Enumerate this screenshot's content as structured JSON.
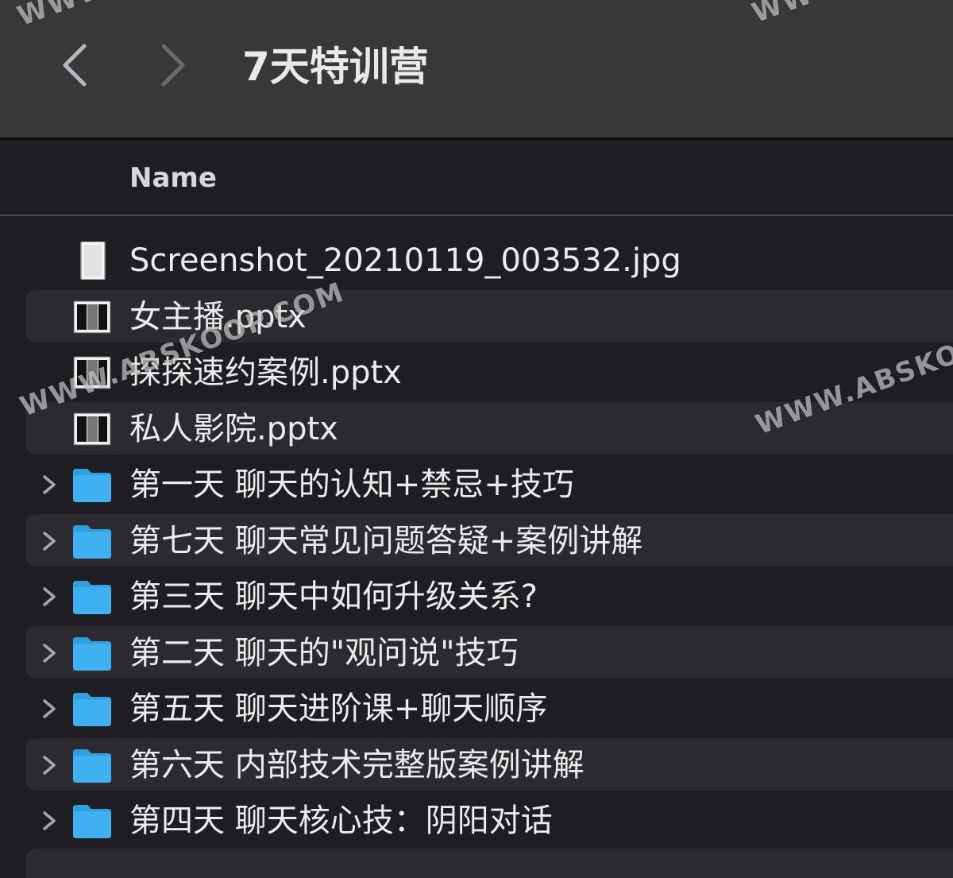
{
  "window": {
    "title": "7天特训营"
  },
  "header": {
    "name_label": "Name"
  },
  "files": [
    {
      "name": "Screenshot_20210119_003532.jpg",
      "kind": "image",
      "icon": "image-file-icon",
      "expandable": false
    },
    {
      "name": "女主播.pptx",
      "kind": "pptx",
      "icon": "pptx-file-icon",
      "expandable": false
    },
    {
      "name": "探探速约案例.pptx",
      "kind": "pptx",
      "icon": "pptx-file-icon",
      "expandable": false
    },
    {
      "name": "私人影院.pptx",
      "kind": "pptx",
      "icon": "pptx-file-icon",
      "expandable": false
    },
    {
      "name": "第一天 聊天的认知+禁忌+技巧",
      "kind": "folder",
      "icon": "folder-icon",
      "expandable": true
    },
    {
      "name": "第七天 聊天常见问题答疑+案例讲解",
      "kind": "folder",
      "icon": "folder-icon",
      "expandable": true
    },
    {
      "name": "第三天 聊天中如何升级关系?",
      "kind": "folder",
      "icon": "folder-icon",
      "expandable": true
    },
    {
      "name": "第二天 聊天的\"观问说\"技巧",
      "kind": "folder",
      "icon": "folder-icon",
      "expandable": true
    },
    {
      "name": "第五天 聊天进阶课+聊天顺序",
      "kind": "folder",
      "icon": "folder-icon",
      "expandable": true
    },
    {
      "name": "第六天 内部技术完整版案例讲解",
      "kind": "folder",
      "icon": "folder-icon",
      "expandable": true
    },
    {
      "name": "第四天 聊天核心技：阴阳对话",
      "kind": "folder",
      "icon": "folder-icon",
      "expandable": true
    }
  ],
  "watermarks": {
    "wm1": "WWW.ABSKOOP.COM",
    "wm2": "WWW.ABSKO",
    "wm3": "WWW",
    "wm4": "WWW"
  },
  "colors": {
    "toolbar_bg": "#3a373b",
    "list_bg": "#1f1d22",
    "alt_row_bg": "#2c2a2f",
    "folder_blue": "#3fb0f0",
    "text": "#ebebec"
  }
}
